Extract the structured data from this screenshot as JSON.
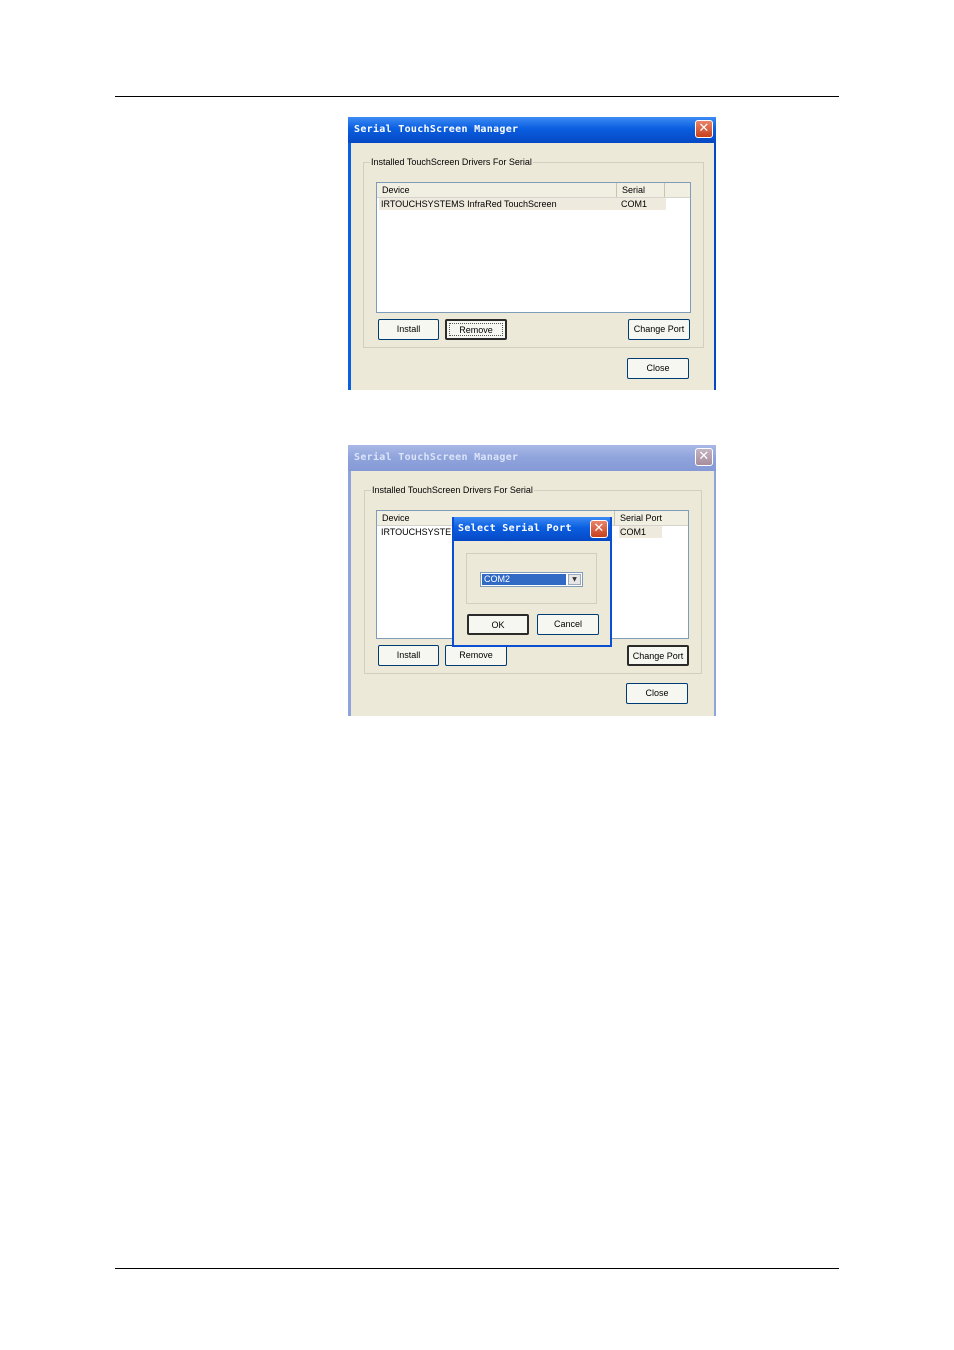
{
  "dialog1": {
    "title": "Serial TouchScreen Manager",
    "close_glyph": "✕",
    "group_label": "Installed TouchScreen Drivers For Serial",
    "columns": [
      "Device",
      "Serial Port"
    ],
    "rows": [
      {
        "device": "IRTOUCHSYSTEMS InfraRed TouchScreen",
        "port": "COM1"
      }
    ],
    "buttons": {
      "install": "Install",
      "remove": "Remove",
      "change_port": "Change Port",
      "close": "Close"
    }
  },
  "dialog2": {
    "title": "Serial TouchScreen Manager",
    "close_glyph": "✕",
    "group_label": "Installed TouchScreen Drivers For Serial",
    "columns": [
      "Device",
      "Serial Port"
    ],
    "rows": [
      {
        "device": "IRTOUCHSYSTE",
        "port": "COM1"
      }
    ],
    "buttons": {
      "install": "Install",
      "remove": "Remove",
      "change_port": "Change Port",
      "close": "Close"
    }
  },
  "select_port_dialog": {
    "title": "Select Serial Port",
    "close_glyph": "✕",
    "selected_port": "COM2",
    "ok": "OK",
    "cancel": "Cancel"
  },
  "colors": {
    "titlebar_active": "#0a5ee0",
    "titlebar_inactive": "#8fa3dc",
    "dialog_face": "#ece9d8",
    "selection": "#316ac5"
  }
}
